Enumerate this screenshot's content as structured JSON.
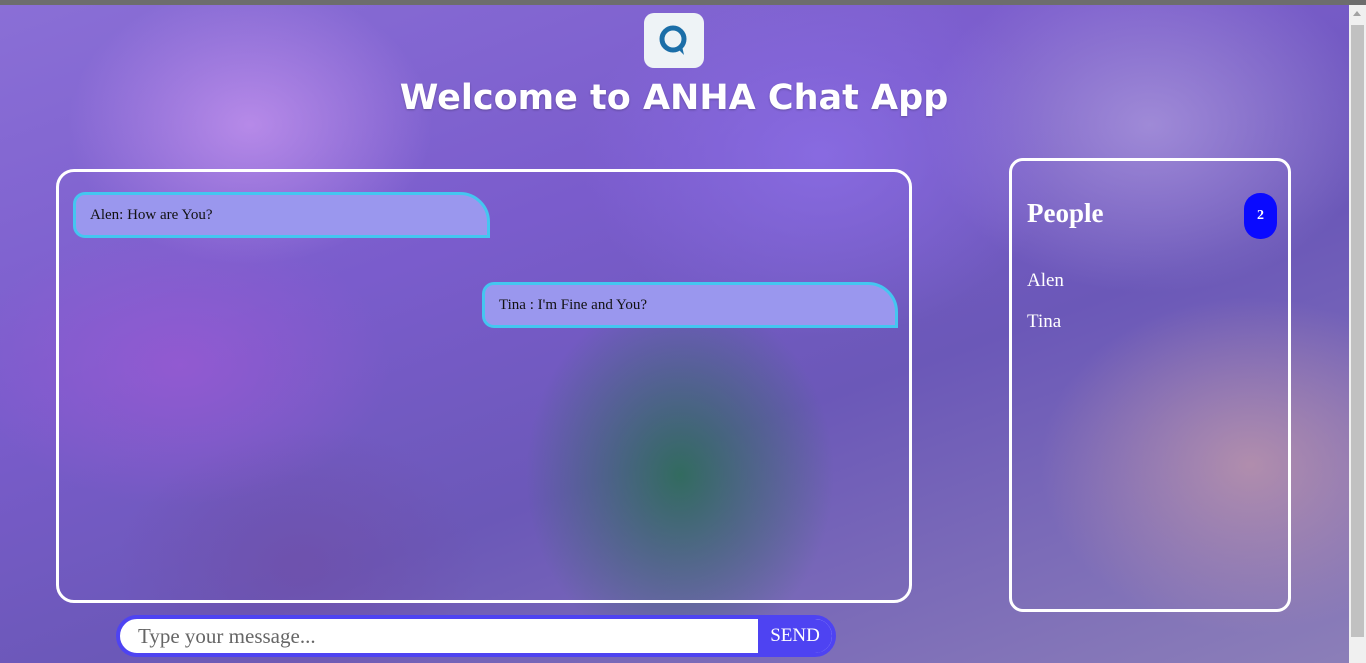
{
  "app": {
    "title": "Welcome to ANHA Chat App",
    "logo_icon": "chat-bubble-q-icon"
  },
  "chat": {
    "messages": [
      {
        "side": "left",
        "text": "Alen: How are You?"
      },
      {
        "side": "right",
        "text": "Tina : I'm Fine and You?"
      }
    ]
  },
  "people": {
    "title": "People",
    "count": "2",
    "list": [
      "Alen",
      "Tina"
    ]
  },
  "composer": {
    "placeholder": "Type your message...",
    "send_label": "SEND"
  },
  "colors": {
    "bubble_bg": "#9a97ee",
    "bubble_border": "#44c6f0",
    "count_badge": "#0a0aff",
    "send_button": "#4e43f2"
  }
}
